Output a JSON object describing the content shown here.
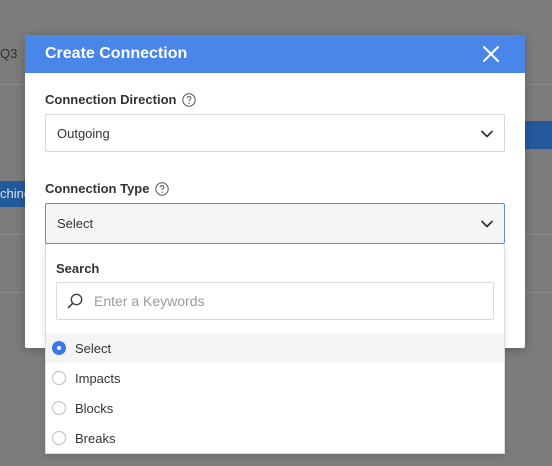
{
  "background": {
    "fragment_text": "Q3",
    "button_fragment": "chine"
  },
  "modal": {
    "title": "Create Connection",
    "direction": {
      "label": "Connection Direction",
      "value": "Outgoing"
    },
    "type": {
      "label": "Connection Type",
      "value": "Select"
    }
  },
  "dropdown": {
    "search_label": "Search",
    "search_placeholder": "Enter a Keywords",
    "search_value": "",
    "options": [
      {
        "label": "Select",
        "selected": true
      },
      {
        "label": "Impacts",
        "selected": false
      },
      {
        "label": "Blocks",
        "selected": false
      },
      {
        "label": "Breaks",
        "selected": false
      }
    ]
  },
  "colors": {
    "header": "#4a86e8",
    "radio_selected": "#3b78e7",
    "overlay": "#7c7c7c"
  }
}
